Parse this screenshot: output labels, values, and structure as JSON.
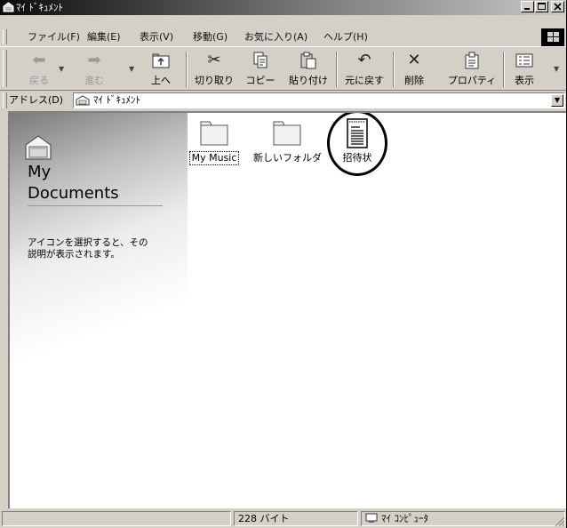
{
  "window": {
    "title": "ﾏｲ ﾄﾞｷｭﾒﾝﾄ"
  },
  "menubar": {
    "items": [
      {
        "label": "ファイル(F)"
      },
      {
        "label": "編集(E)"
      },
      {
        "label": "表示(V)"
      },
      {
        "label": "移動(G)"
      },
      {
        "label": "お気に入り(A)"
      },
      {
        "label": "ヘルプ(H)"
      }
    ]
  },
  "toolbar": {
    "back": "戻る",
    "forward": "進む",
    "up": "上へ",
    "cut": "切り取り",
    "copy": "コピー",
    "paste": "貼り付け",
    "undo": "元に戻す",
    "delete": "削除",
    "properties": "プロパティ",
    "views": "表示"
  },
  "address": {
    "label": "アドレス(D)",
    "value": "ﾏｲ ﾄﾞｷｭﾒﾝﾄ"
  },
  "leftpanel": {
    "title_line1": "My",
    "title_line2": "Documents",
    "description": "アイコンを選択すると、その\n説明が表示されます。"
  },
  "files": [
    {
      "name": "My Music",
      "type": "folder",
      "icon": "folder-icon"
    },
    {
      "name": "新しいフォルダ",
      "type": "folder",
      "icon": "folder-icon"
    },
    {
      "name": "招待状",
      "type": "document",
      "icon": "document-icon",
      "highlighted": true
    }
  ],
  "statusbar": {
    "size": "228 バイト",
    "zone": "ﾏｲ ｺﾝﾋﾟｭｰﾀ"
  }
}
